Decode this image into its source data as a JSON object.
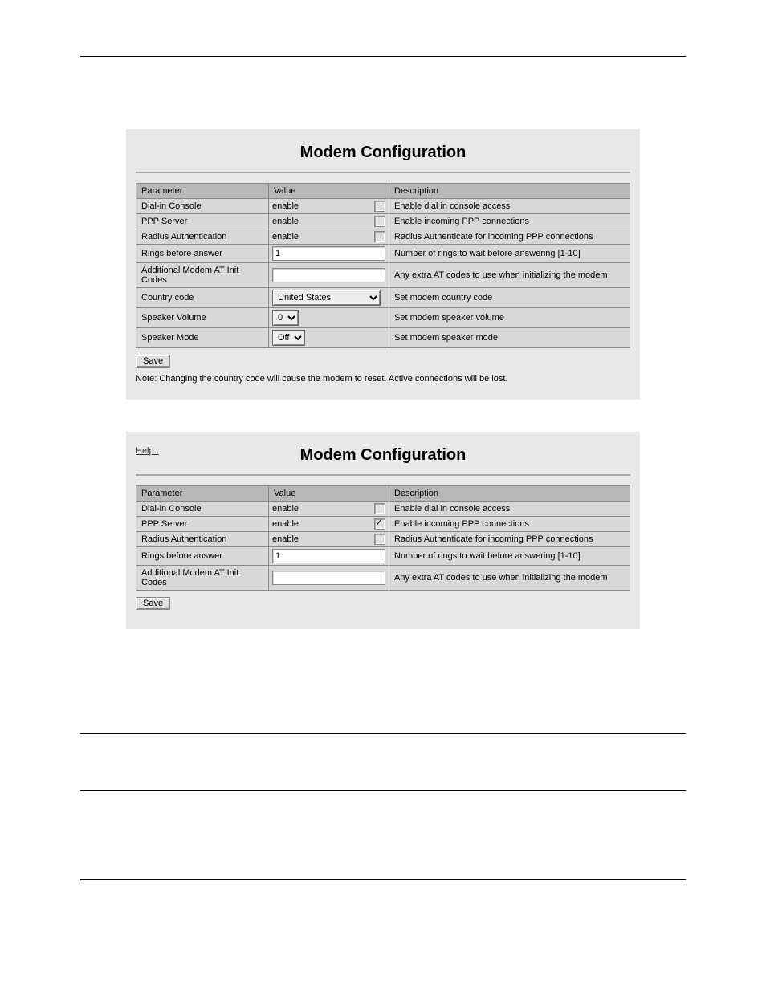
{
  "panel1": {
    "title": "Modem Configuration",
    "headers": {
      "param": "Parameter",
      "value": "Value",
      "desc": "Description"
    },
    "rows": [
      {
        "param": "Dial-in Console",
        "type": "checkbox",
        "value_label": "enable",
        "checked": false,
        "desc": "Enable dial in console access"
      },
      {
        "param": "PPP Server",
        "type": "checkbox",
        "value_label": "enable",
        "checked": false,
        "desc": "Enable incoming PPP connections"
      },
      {
        "param": "Radius Authentication",
        "type": "checkbox",
        "value_label": "enable",
        "checked": false,
        "desc": "Radius Authenticate for incoming PPP connections"
      },
      {
        "param": "Rings before answer",
        "type": "text",
        "value": "1",
        "desc": "Number of rings to wait before answering [1-10]"
      },
      {
        "param": "Additional Modem AT Init Codes",
        "type": "text",
        "value": "",
        "desc": "Any extra AT codes to use when initializing the modem"
      },
      {
        "param": "Country code",
        "type": "select",
        "value": "United States",
        "desc": "Set modem country code"
      },
      {
        "param": "Speaker Volume",
        "type": "select-small",
        "value": "0",
        "desc": "Set modem speaker volume"
      },
      {
        "param": "Speaker Mode",
        "type": "select-small",
        "value": "Off",
        "desc": "Set modem speaker mode"
      }
    ],
    "save": "Save",
    "note": "Note: Changing the country code will cause the modem to reset. Active connections will be lost."
  },
  "panel2": {
    "help": "Help..",
    "title": "Modem Configuration",
    "headers": {
      "param": "Parameter",
      "value": "Value",
      "desc": "Description"
    },
    "rows": [
      {
        "param": "Dial-in Console",
        "type": "checkbox",
        "value_label": "enable",
        "checked": false,
        "desc": "Enable dial in console access"
      },
      {
        "param": "PPP Server",
        "type": "checkbox",
        "value_label": "enable",
        "checked": true,
        "desc": "Enable incoming PPP connections"
      },
      {
        "param": "Radius Authentication",
        "type": "checkbox",
        "value_label": "enable",
        "checked": false,
        "desc": "Radius Authenticate for incoming PPP connections"
      },
      {
        "param": "Rings before answer",
        "type": "text",
        "value": "1",
        "desc": "Number of rings to wait before answering [1-10]"
      },
      {
        "param": "Additional Modem AT Init Codes",
        "type": "text",
        "value": "",
        "desc": "Any extra AT codes to use when initializing the modem"
      }
    ],
    "save": "Save"
  }
}
